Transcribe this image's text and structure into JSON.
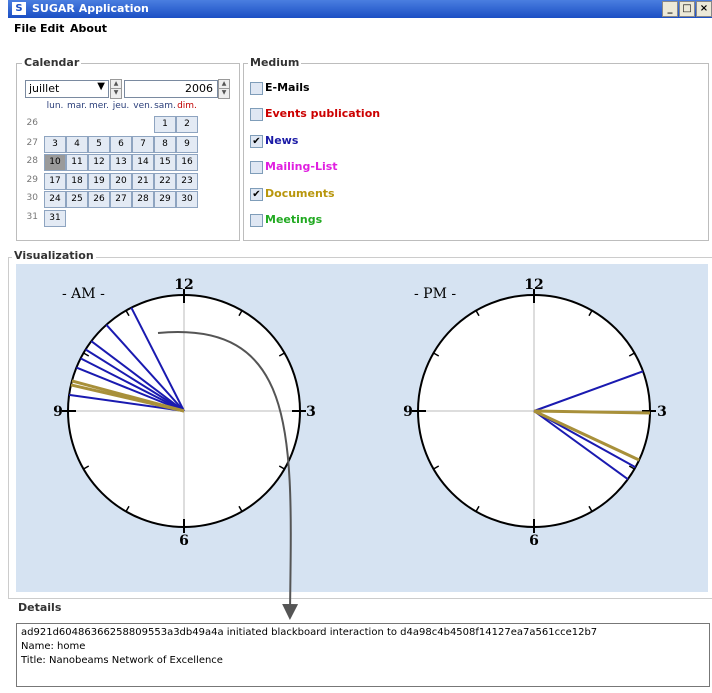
{
  "window": {
    "title": "SUGAR Application",
    "icon_letter": "S",
    "minimize": "_",
    "maximize": "□",
    "close": "×"
  },
  "menu": [
    "File",
    "Edit",
    "About"
  ],
  "calendar": {
    "legend": "Calendar",
    "month": "juillet",
    "year": "2006",
    "weekday_headers": [
      "lun.",
      "mar.",
      "mer.",
      "jeu.",
      "ven.",
      "sam.",
      "dim."
    ],
    "week_numbers": [
      "26",
      "27",
      "28",
      "29",
      "30",
      "31"
    ],
    "weeks": [
      [
        "",
        "",
        "",
        "",
        "",
        "1",
        "2"
      ],
      [
        "3",
        "4",
        "5",
        "6",
        "7",
        "8",
        "9"
      ],
      [
        "10",
        "11",
        "12",
        "13",
        "14",
        "15",
        "16"
      ],
      [
        "17",
        "18",
        "19",
        "20",
        "21",
        "22",
        "23"
      ],
      [
        "24",
        "25",
        "26",
        "27",
        "28",
        "29",
        "30"
      ],
      [
        "31",
        "",
        "",
        "",
        "",
        "",
        ""
      ]
    ],
    "selected_day": "10"
  },
  "medium": {
    "legend": "Medium",
    "items": [
      {
        "label": "E-Mails",
        "checked": false,
        "color": "#000000"
      },
      {
        "label": "Events publication",
        "checked": false,
        "color": "#cc0000"
      },
      {
        "label": "News",
        "checked": true,
        "color": "#1a1aa6"
      },
      {
        "label": "Mailing-List",
        "checked": false,
        "color": "#e020e0"
      },
      {
        "label": "Documents",
        "checked": true,
        "color": "#b8960c"
      },
      {
        "label": "Meetings",
        "checked": false,
        "color": "#22aa22"
      }
    ]
  },
  "visualization": {
    "legend": "Visualization",
    "am_label": "- AM -",
    "pm_label": "- PM -",
    "hour_labels": {
      "top": "12",
      "right": "3",
      "bottom": "6",
      "left": "9"
    },
    "colors": {
      "news": "#1a1ab0",
      "documents": "#a8903a",
      "link_arrow": "#555555"
    }
  },
  "details": {
    "legend": "Details",
    "lines": [
      "ad921d60486366258809553a3db49a4a initiated blackboard interaction to d4a98c4b4508f14127ea7a561cce12b7",
      "Name: home",
      "Title:  Nanobeams Network of Excellence"
    ]
  }
}
